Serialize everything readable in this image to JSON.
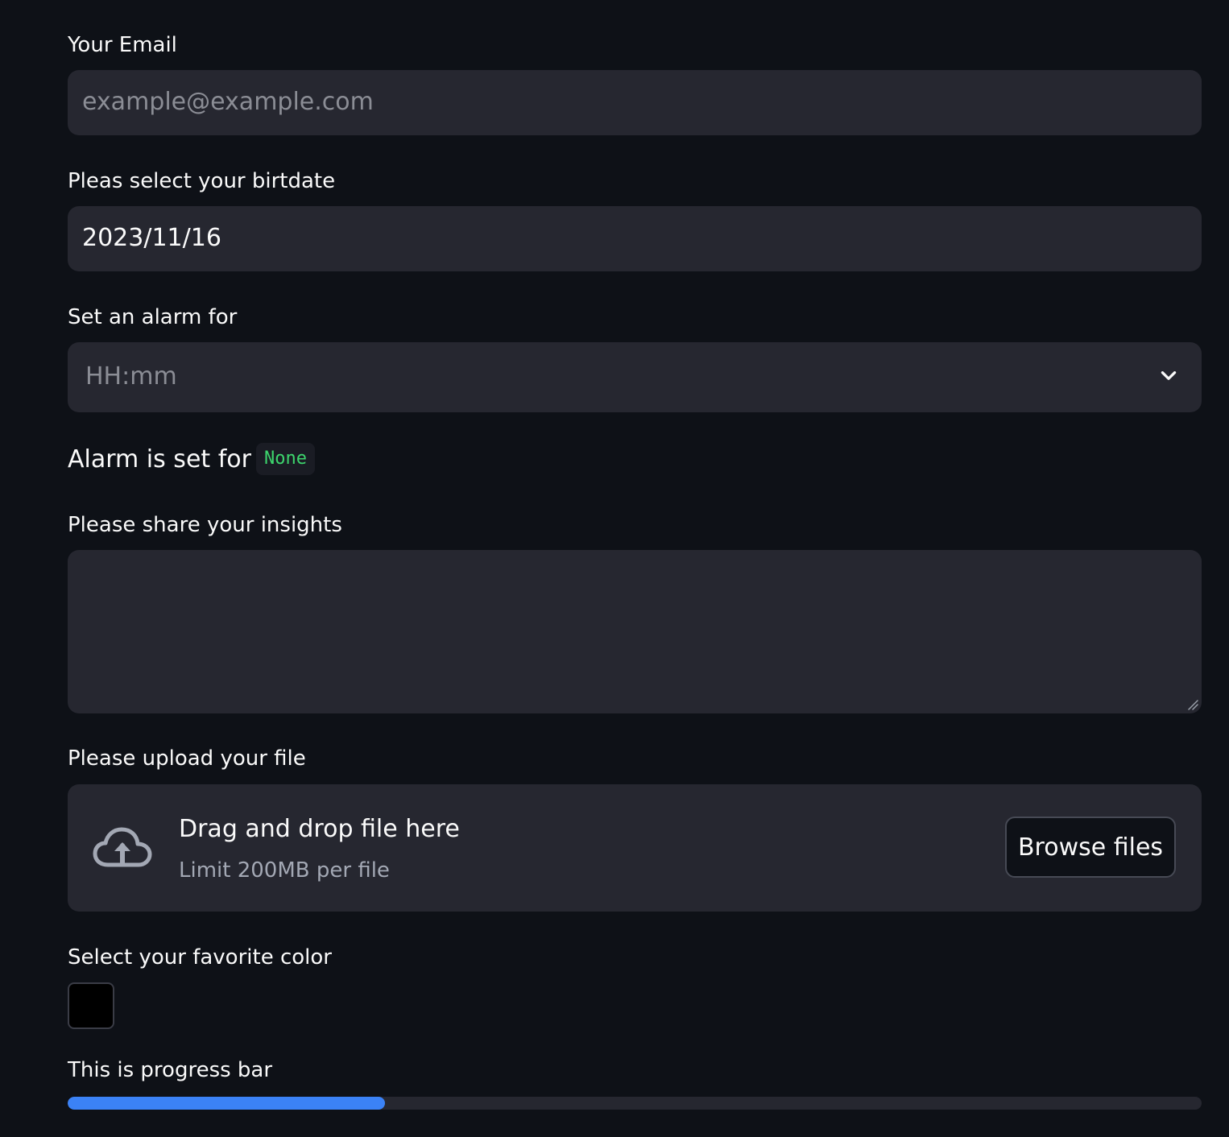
{
  "email": {
    "label": "Your Email",
    "placeholder": "example@example.com"
  },
  "birthdate": {
    "label": "Pleas select your birtdate",
    "value": "2023/11/16"
  },
  "alarm": {
    "label": "Set an alarm for",
    "placeholder": "HH:mm",
    "status_text": "Alarm is set for",
    "status_value": "None"
  },
  "insights": {
    "label": "Please share your insights",
    "value": ""
  },
  "upload": {
    "label": "Please upload your file",
    "title": "Drag and drop file here",
    "limit": "Limit 200MB per file",
    "button_label": "Browse files",
    "icon": "cloud-upload-icon"
  },
  "color": {
    "label": "Select your favorite color",
    "value": "#000000"
  },
  "progress": {
    "label": "This is progress bar",
    "percent": 28
  },
  "theme": {
    "background": "#0e1117",
    "field_background": "#262730",
    "accent": "#3b82f6",
    "code_green": "#3dd56d"
  }
}
